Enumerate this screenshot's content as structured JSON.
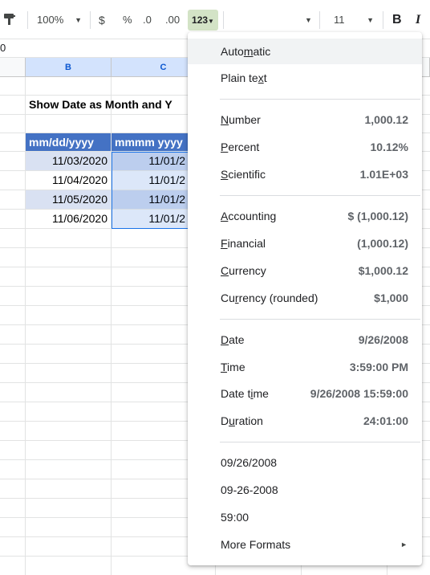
{
  "toolbar": {
    "zoom": "100%",
    "currency_symbol": "$",
    "percent_symbol": "%",
    "decrease_decimal": ".0",
    "increase_decimal": ".00",
    "more_formats": "123",
    "font_size": "11",
    "bold": "B",
    "italic": "I"
  },
  "formula_bar": {
    "text": "0"
  },
  "columns": [
    {
      "label": "B"
    },
    {
      "label": "C"
    }
  ],
  "sheet": {
    "title": "Show Date as Month and Y",
    "headers": [
      "mm/dd/yyyy",
      "mmmm yyyy"
    ],
    "rows": [
      [
        "11/03/2020",
        "11/01/2"
      ],
      [
        "11/04/2020",
        "11/01/2"
      ],
      [
        "11/05/2020",
        "11/01/2"
      ],
      [
        "11/06/2020",
        "11/01/2"
      ]
    ]
  },
  "menu": {
    "items": [
      {
        "pre": "Auto",
        "ul": "m",
        "post": "atic",
        "value": ""
      },
      {
        "pre": "Plain te",
        "ul": "x",
        "post": "t",
        "value": ""
      },
      {
        "pre": "",
        "ul": "N",
        "post": "umber",
        "value": "1,000.12"
      },
      {
        "pre": "",
        "ul": "P",
        "post": "ercent",
        "value": "10.12%"
      },
      {
        "pre": "",
        "ul": "S",
        "post": "cientific",
        "value": "1.01E+03"
      },
      {
        "pre": "",
        "ul": "A",
        "post": "ccounting",
        "value": "$ (1,000.12)"
      },
      {
        "pre": "",
        "ul": "F",
        "post": "inancial",
        "value": "(1,000.12)"
      },
      {
        "pre": "",
        "ul": "C",
        "post": "urrency",
        "value": "$1,000.12"
      },
      {
        "pre": "Cu",
        "ul": "r",
        "post": "rency (rounded)",
        "value": "$1,000"
      },
      {
        "pre": "",
        "ul": "D",
        "post": "ate",
        "value": "9/26/2008"
      },
      {
        "pre": "",
        "ul": "T",
        "post": "ime",
        "value": "3:59:00 PM"
      },
      {
        "pre": "Date t",
        "ul": "i",
        "post": "me",
        "value": "9/26/2008 15:59:00"
      },
      {
        "pre": "D",
        "ul": "u",
        "post": "ration",
        "value": "24:01:00"
      },
      {
        "pre": "09/26/2008",
        "ul": "",
        "post": "",
        "value": ""
      },
      {
        "pre": "09-26-2008",
        "ul": "",
        "post": "",
        "value": ""
      },
      {
        "pre": "59:00",
        "ul": "",
        "post": "",
        "value": ""
      },
      {
        "pre": "More Formats",
        "ul": "",
        "post": "",
        "value": ""
      }
    ]
  },
  "colors": {
    "header_fill": "#4472c4",
    "row_fill_dark": "#d9e1f2",
    "selection": "#1a73e8",
    "format_button": "#d3e3c6"
  }
}
